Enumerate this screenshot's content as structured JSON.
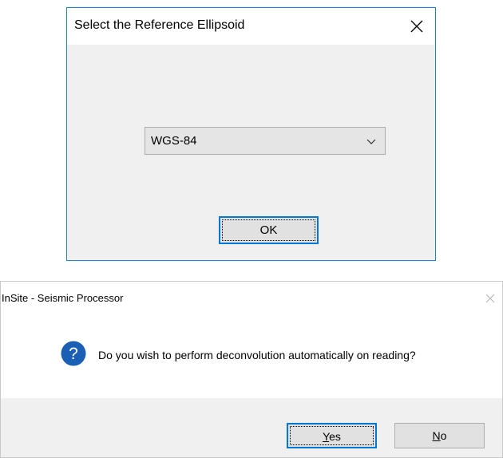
{
  "ellipsoid_dialog": {
    "title": "Select the Reference Ellipsoid",
    "close_icon": "close-icon",
    "combo": {
      "selected_value": "WGS-84",
      "arrow_icon": "chevron-down-icon"
    },
    "ok_label": "OK",
    "accent_color": "#1883d7"
  },
  "confirm_dialog": {
    "title": "InSite - Seismic Processor",
    "close_icon": "close-icon",
    "icon": "question-icon",
    "message": "Do you wish to perform deconvolution automatically on reading?",
    "yes_mnemonic": "Y",
    "yes_rest": "es",
    "no_mnemonic": "N",
    "no_rest": "o",
    "icon_color": "#1a5fb4"
  }
}
